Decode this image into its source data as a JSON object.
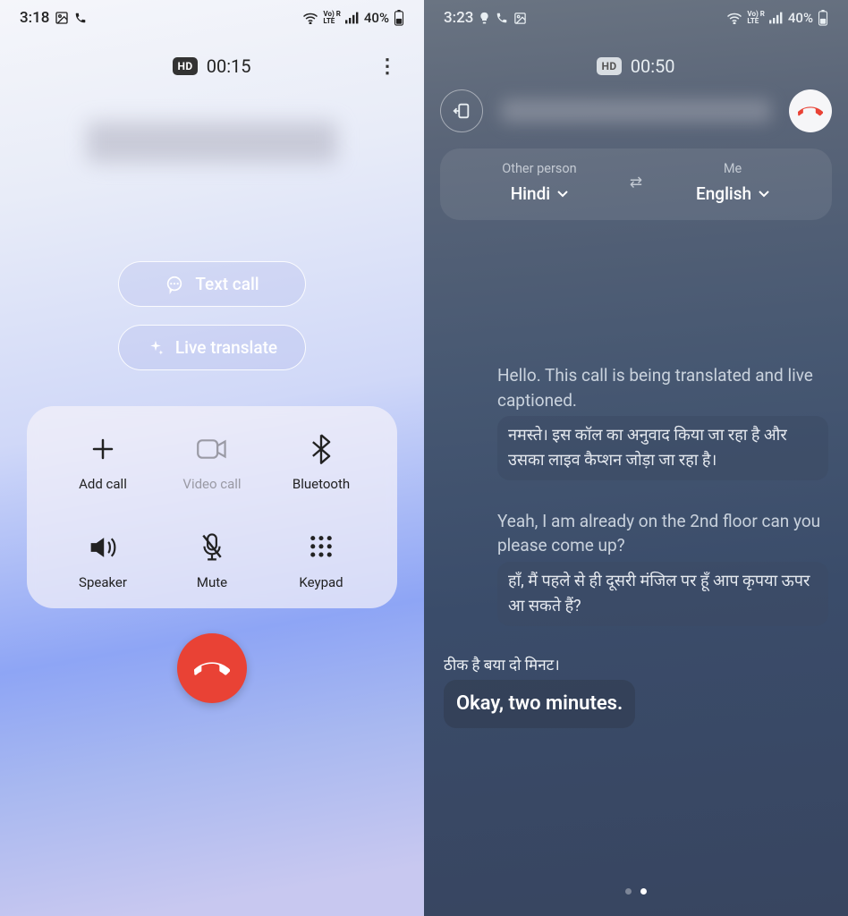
{
  "left": {
    "status": {
      "time": "3:18",
      "battery": "40%"
    },
    "call": {
      "hd": "HD",
      "duration": "00:15"
    },
    "pills": {
      "text_call": "Text call",
      "live_translate": "Live translate"
    },
    "controls": {
      "add_call": "Add call",
      "video_call": "Video call",
      "bluetooth": "Bluetooth",
      "speaker": "Speaker",
      "mute": "Mute",
      "keypad": "Keypad"
    }
  },
  "right": {
    "status": {
      "time": "3:23",
      "battery": "40%"
    },
    "call": {
      "hd": "HD",
      "duration": "00:50"
    },
    "lang": {
      "other_label": "Other person",
      "other_value": "Hindi",
      "me_label": "Me",
      "me_value": "English"
    },
    "transcript": [
      {
        "side": "right",
        "orig": "Hello. This call is being translated and live captioned.",
        "trans": "नमस्ते। इस कॉल का अनुवाद किया जा रहा है और उसका लाइव कैप्शन जोड़ा जा रहा है।"
      },
      {
        "side": "right",
        "orig": "Yeah, I am already on the 2nd floor can you please come up?",
        "trans": "हाँ, मैं पहले से ही दूसरी मंजिल पर हूँ आप कृपया ऊपर आ सकते हैं?"
      },
      {
        "side": "left",
        "orig": "ठीक है बया दो मिनट।",
        "trans": "Okay, two minutes."
      }
    ]
  }
}
